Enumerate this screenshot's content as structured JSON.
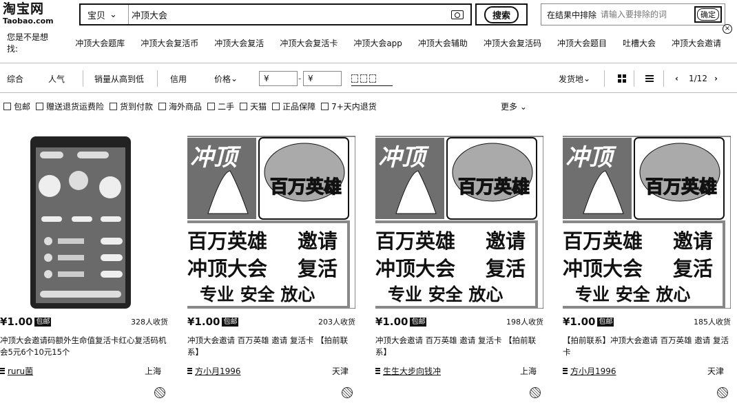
{
  "logo": {
    "cn": "淘宝网",
    "en": "Taobao.com"
  },
  "search": {
    "type_label": "宝贝",
    "query": "冲顶大会",
    "button_label": "搜索"
  },
  "exclude": {
    "label": "在结果中排除",
    "placeholder": "请输入要排除的词",
    "ok_label": "确定"
  },
  "close_label": "×",
  "suggestions": {
    "title": "您是不是想找:",
    "items": [
      "冲顶大会题库",
      "冲顶大会复活币",
      "冲顶大会复活",
      "冲顶大会复活卡",
      "冲顶大会app",
      "冲顶大会辅助",
      "冲顶大会复活码",
      "冲顶大会题目",
      "吐槽大会",
      "冲顶大会邀请"
    ]
  },
  "sort": {
    "items": [
      "综合",
      "人气",
      "销量从高到低",
      "信用",
      "价格"
    ],
    "price_from": "¥",
    "price_to": "¥",
    "ship_from": "发货地",
    "page": "1/12"
  },
  "filters": [
    "包邮",
    "赠送退货运费险",
    "货到付款",
    "海外商品",
    "二手",
    "天猫",
    "正品保障",
    "7+天内退货"
  ],
  "more_label": "更多",
  "poster": {
    "logo_text": "冲顶",
    "badge_text": "百万英雄",
    "line1_left": "百万英雄",
    "line1_right": "邀请",
    "line2_left": "冲顶大会",
    "line2_right": "复活",
    "line3": "专业 安全 放心"
  },
  "products": [
    {
      "price": "¥1.00",
      "badge": "包邮",
      "sales": "328人收货",
      "title": "冲顶大会邀请码额外生命值复活卡红心复活码机会5元6个10元15个",
      "shop": "ruru菌",
      "location": "上海"
    },
    {
      "price": "¥1.00",
      "badge": "包邮",
      "sales": "203人收货",
      "title": "冲顶大会邀请 百万英雄 邀请 复活卡 【拍前联系】",
      "shop": "方小月1996",
      "location": "天津"
    },
    {
      "price": "¥1.00",
      "badge": "包邮",
      "sales": "198人收货",
      "title": "冲顶大会邀请 百万英雄 邀请 复活卡 【拍前联系】",
      "shop": "生生大步向钱冲",
      "location": "上海"
    },
    {
      "price": "¥1.00",
      "badge": "包邮",
      "sales": "185人收货",
      "title": "【拍前联系】冲顶大会邀请 百万英雄 邀请 复活卡",
      "shop": "方小月1996",
      "location": "天津"
    }
  ]
}
